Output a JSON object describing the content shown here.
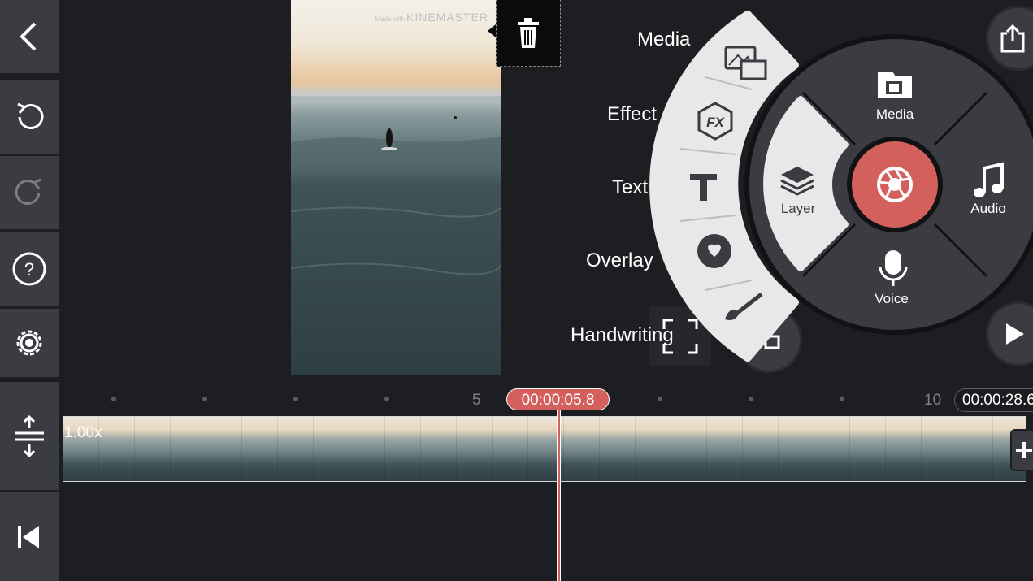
{
  "preview": {
    "watermark_small": "Made with",
    "watermark_brand": "KINEMASTER"
  },
  "media_menu": {
    "labels": [
      "Media",
      "Effect",
      "Text",
      "Overlay",
      "Handwriting"
    ]
  },
  "wheel": {
    "media": "Media",
    "layer": "Layer",
    "audio": "Audio",
    "voice": "Voice",
    "record_color": "#d3605d"
  },
  "timeline": {
    "playhead_time": "00:00:05.8",
    "total_time": "00:00:28.6",
    "ruler_labels": [
      "5",
      "10"
    ],
    "clip_speed": "1.00x"
  },
  "left_toolbar": {
    "icons": [
      "back-icon",
      "undo-icon",
      "redo-icon",
      "help-icon",
      "settings-icon",
      "timeline-expand-icon",
      "skip-to-start-icon"
    ]
  },
  "colors": {
    "accent": "#d3605d",
    "panel": "#3a3c42",
    "background": "#1d1e22"
  }
}
